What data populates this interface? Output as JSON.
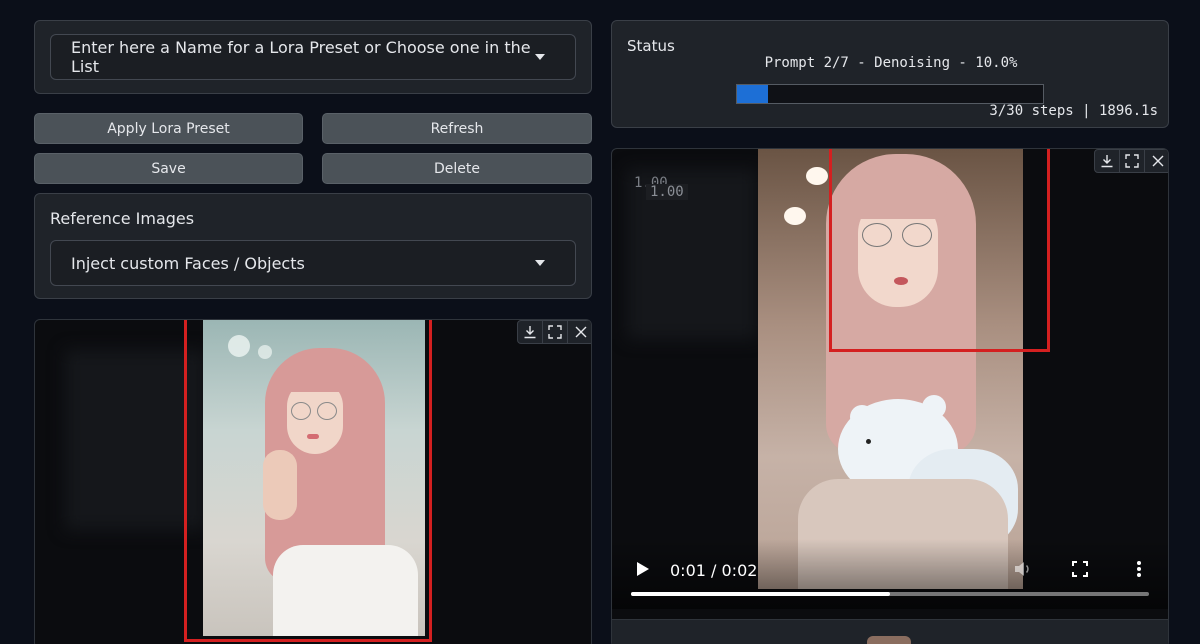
{
  "lora_preset": {
    "placeholder": "Enter here a Name for a Lora Preset or Choose one in the List"
  },
  "buttons": {
    "apply": "Apply Lora Preset",
    "refresh": "Refresh",
    "save": "Save",
    "delete": "Delete"
  },
  "reference_images": {
    "label": "Reference Images",
    "selected": "Inject custom Faces / Objects"
  },
  "status": {
    "label": "Status",
    "progress_text": "Prompt 2/7 - Denoising - 10.0%",
    "progress": 0.1,
    "steps_text": "3/30 steps | 1896.1s"
  },
  "video": {
    "time": "0:01 / 0:02",
    "badge": "1.00",
    "played_fraction": 0.5
  },
  "icons": [
    "download-icon",
    "fullscreen-icon",
    "close-icon",
    "play-icon",
    "volume-icon",
    "more-icon",
    "dropdown-caret-icon"
  ],
  "colors": {
    "accent": "#1d6fd6",
    "highlight_box": "#d42020",
    "background": "#0b0f19"
  }
}
